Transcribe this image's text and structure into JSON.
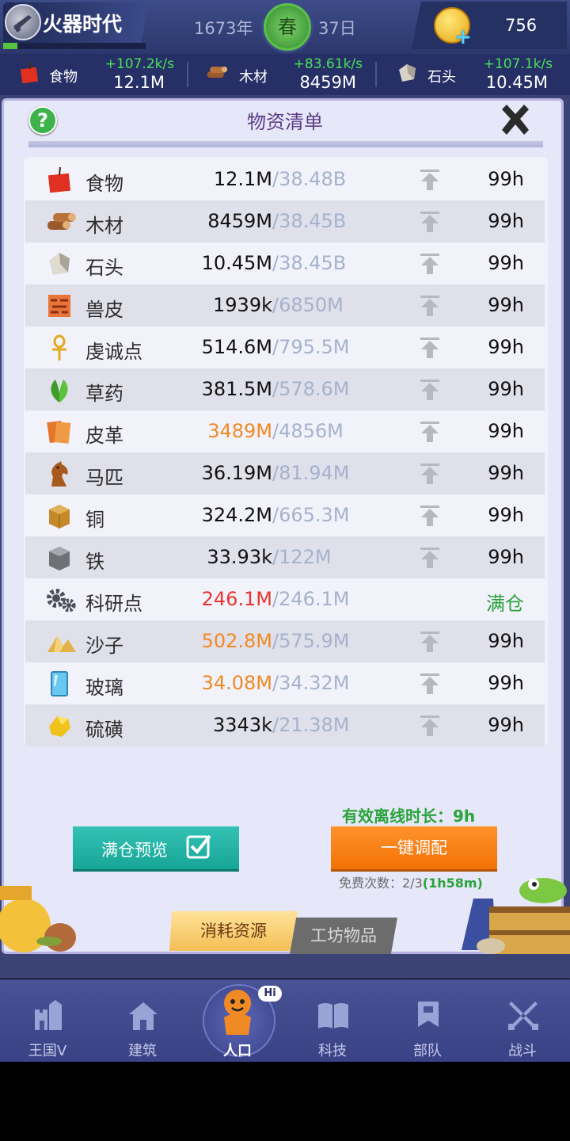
{
  "header": {
    "age_title": "火器时代",
    "year": "1673年",
    "season": "春",
    "day": "37日",
    "coins": "756",
    "age_progress": 0.1
  },
  "resource_bar": [
    {
      "name": "食物",
      "rate": "+107.2k/s",
      "amount": "12.1M",
      "icon": "apple-icon"
    },
    {
      "name": "木材",
      "rate": "+83.61k/s",
      "amount": "8459M",
      "icon": "logs-icon"
    },
    {
      "name": "石头",
      "rate": "+107.1k/s",
      "amount": "10.45M",
      "icon": "stone-icon"
    }
  ],
  "panel": {
    "title": "物资清单",
    "rows": [
      {
        "name": "食物",
        "amount": "12.1M",
        "cap": "/38.48B",
        "time": "99h",
        "amount_color": "normal",
        "icon": "apple-icon"
      },
      {
        "name": "木材",
        "amount": "8459M",
        "cap": "/38.45B",
        "time": "99h",
        "amount_color": "normal",
        "icon": "logs-icon"
      },
      {
        "name": "石头",
        "amount": "10.45M",
        "cap": "/38.45B",
        "time": "99h",
        "amount_color": "normal",
        "icon": "stone-icon"
      },
      {
        "name": "兽皮",
        "amount": "1939k",
        "cap": "/6850M",
        "time": "99h",
        "amount_color": "normal",
        "icon": "hide-icon"
      },
      {
        "name": "虔诚点",
        "amount": "514.6M",
        "cap": "/795.5M",
        "time": "99h",
        "amount_color": "normal",
        "icon": "ankh-icon"
      },
      {
        "name": "草药",
        "amount": "381.5M",
        "cap": "/578.6M",
        "time": "99h",
        "amount_color": "normal",
        "icon": "herb-icon"
      },
      {
        "name": "皮革",
        "amount": "3489M",
        "cap": "/4856M",
        "time": "99h",
        "amount_color": "orange",
        "icon": "leather-icon"
      },
      {
        "name": "马匹",
        "amount": "36.19M",
        "cap": "/81.94M",
        "time": "99h",
        "amount_color": "normal",
        "icon": "horse-icon"
      },
      {
        "name": "铜",
        "amount": "324.2M",
        "cap": "/665.3M",
        "time": "99h",
        "amount_color": "normal",
        "icon": "copper-icon"
      },
      {
        "name": "铁",
        "amount": "33.93k",
        "cap": "/122M",
        "time": "99h",
        "amount_color": "normal",
        "icon": "iron-icon"
      },
      {
        "name": "科研点",
        "amount": "246.1M",
        "cap": "/246.1M",
        "time": "满仓",
        "amount_color": "red",
        "icon": "gears-icon"
      },
      {
        "name": "沙子",
        "amount": "502.8M",
        "cap": "/575.9M",
        "time": "99h",
        "amount_color": "orange",
        "icon": "sand-icon"
      },
      {
        "name": "玻璃",
        "amount": "34.08M",
        "cap": "/34.32M",
        "time": "99h",
        "amount_color": "orange",
        "icon": "glass-icon"
      },
      {
        "name": "硫磺",
        "amount": "3343k",
        "cap": "/21.38M",
        "time": "99h",
        "amount_color": "normal",
        "icon": "sulfur-icon"
      }
    ],
    "offline_duration": "有效离线时长：9h",
    "full_preview_label": "满仓预览",
    "auto_assign_label": "一键调配",
    "free_times_prefix": "免费次数：2/3",
    "free_times_timer": "(1h58m)",
    "tab_consume": "消耗资源",
    "tab_workshop": "工坊物品"
  },
  "nav": [
    {
      "label": "王国V",
      "icon": "castle-icon"
    },
    {
      "label": "建筑",
      "icon": "house-icon"
    },
    {
      "label": "人口",
      "icon": "person-icon"
    },
    {
      "label": "科技",
      "icon": "book-icon"
    },
    {
      "label": "部队",
      "icon": "banner-icon"
    },
    {
      "label": "战斗",
      "icon": "swords-icon"
    }
  ],
  "nav_badge": "Hi"
}
